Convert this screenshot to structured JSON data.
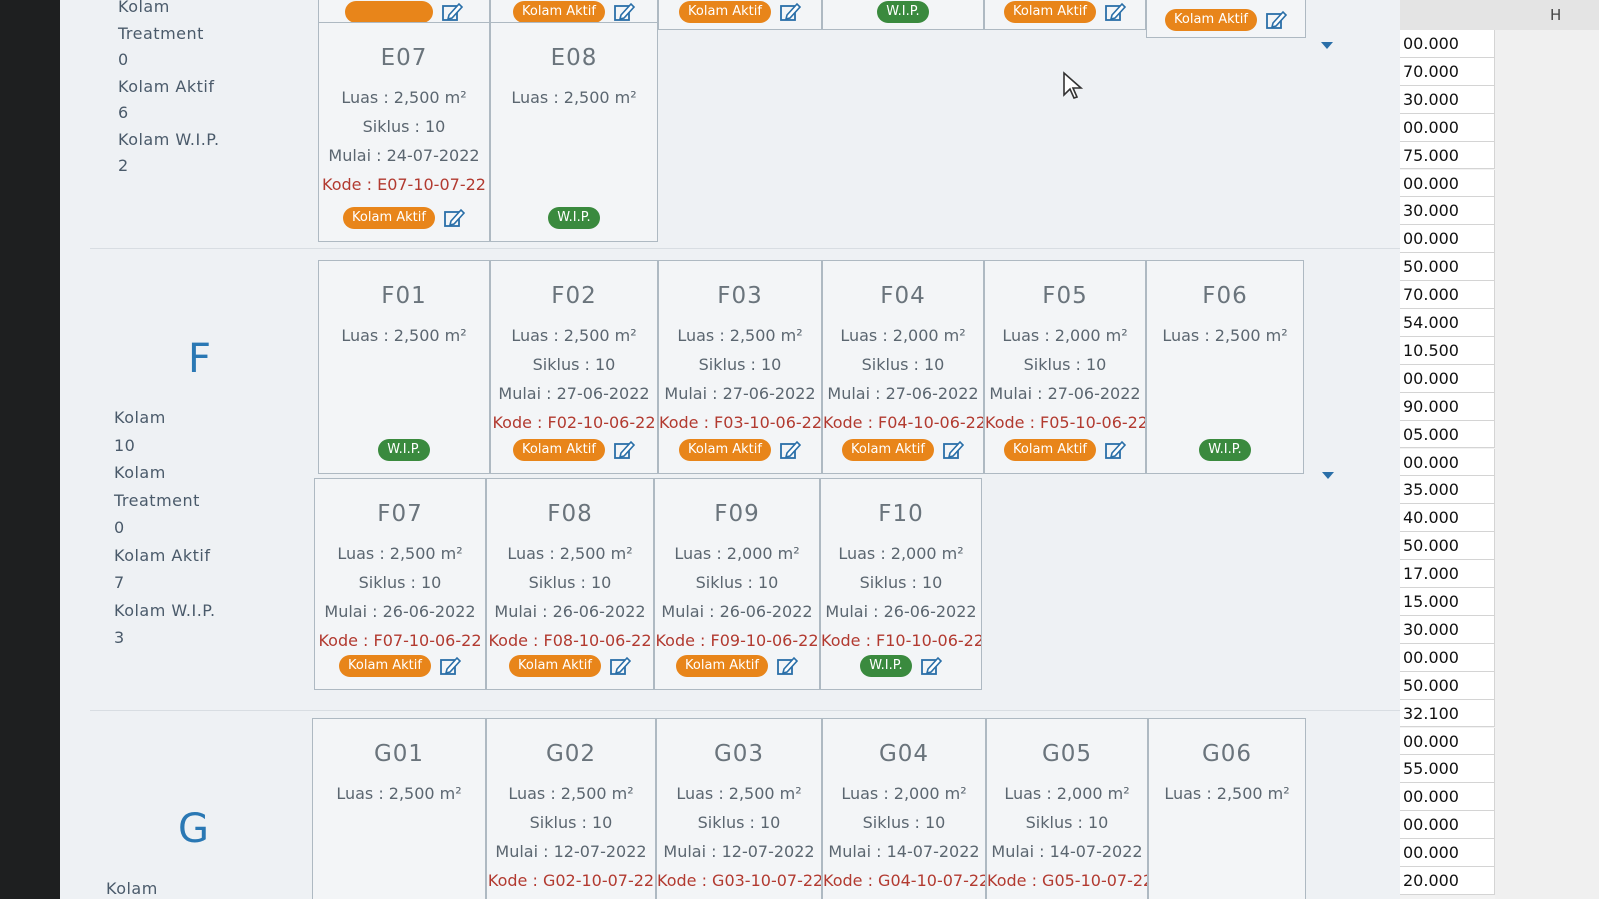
{
  "blocks": {
    "E": {
      "stats": [
        "Kolam",
        "Treatment",
        "0",
        "Kolam Aktif",
        "6",
        "Kolam W.I.P.",
        "2"
      ]
    },
    "F": {
      "letter": "F",
      "stats": [
        "Kolam",
        "10",
        "Kolam",
        "Treatment",
        "0",
        "Kolam Aktif",
        "7",
        "Kolam W.I.P.",
        "3"
      ]
    },
    "G": {
      "letter": "G",
      "stats": [
        "Kolam"
      ]
    }
  },
  "top_partial_badges": [
    "",
    "Kolam Aktif",
    "Kolam Aktif",
    "W.I.P.",
    "Kolam Aktif",
    "Kolam Aktif"
  ],
  "rows": {
    "e2": [
      {
        "code": "E07",
        "luas": "Luas : 2,500 m²",
        "siklus": "Siklus : 10",
        "mulai": "Mulai : 24-07-2022",
        "kode": "Kode : E07-10-07-22",
        "status": "Kolam Aktif"
      },
      {
        "code": "E08",
        "luas": "Luas : 2,500 m²",
        "status": "W.I.P."
      }
    ],
    "f1": [
      {
        "code": "F01",
        "luas": "Luas : 2,500 m²",
        "status": "W.I.P."
      },
      {
        "code": "F02",
        "luas": "Luas : 2,500 m²",
        "siklus": "Siklus : 10",
        "mulai": "Mulai : 27-06-2022",
        "kode": "Kode : F02-10-06-22",
        "status": "Kolam Aktif"
      },
      {
        "code": "F03",
        "luas": "Luas : 2,500 m²",
        "siklus": "Siklus : 10",
        "mulai": "Mulai : 27-06-2022",
        "kode": "Kode : F03-10-06-22",
        "status": "Kolam Aktif"
      },
      {
        "code": "F04",
        "luas": "Luas : 2,000 m²",
        "siklus": "Siklus : 10",
        "mulai": "Mulai : 27-06-2022",
        "kode": "Kode : F04-10-06-22",
        "status": "Kolam Aktif"
      },
      {
        "code": "F05",
        "luas": "Luas : 2,000 m²",
        "siklus": "Siklus : 10",
        "mulai": "Mulai : 27-06-2022",
        "kode": "Kode : F05-10-06-22",
        "status": "Kolam Aktif"
      },
      {
        "code": "F06",
        "luas": "Luas : 2,500 m²",
        "status": "W.I.P."
      }
    ],
    "f2": [
      {
        "code": "F07",
        "luas": "Luas : 2,500 m²",
        "siklus": "Siklus : 10",
        "mulai": "Mulai : 26-06-2022",
        "kode": "Kode : F07-10-06-22",
        "status": "Kolam Aktif"
      },
      {
        "code": "F08",
        "luas": "Luas : 2,500 m²",
        "siklus": "Siklus : 10",
        "mulai": "Mulai : 26-06-2022",
        "kode": "Kode : F08-10-06-22",
        "status": "Kolam Aktif"
      },
      {
        "code": "F09",
        "luas": "Luas : 2,000 m²",
        "siklus": "Siklus : 10",
        "mulai": "Mulai : 26-06-2022",
        "kode": "Kode : F09-10-06-22",
        "status": "Kolam Aktif"
      },
      {
        "code": "F10",
        "luas": "Luas : 2,000 m²",
        "siklus": "Siklus : 10",
        "mulai": "Mulai : 26-06-2022",
        "kode": "Kode : F10-10-06-22",
        "status": "W.I.P."
      }
    ],
    "g1": [
      {
        "code": "G01",
        "luas": "Luas : 2,500 m²"
      },
      {
        "code": "G02",
        "luas": "Luas : 2,500 m²",
        "siklus": "Siklus : 10",
        "mulai": "Mulai : 12-07-2022",
        "kode": "Kode : G02-10-07-22"
      },
      {
        "code": "G03",
        "luas": "Luas : 2,500 m²",
        "siklus": "Siklus : 10",
        "mulai": "Mulai : 12-07-2022",
        "kode": "Kode : G03-10-07-22"
      },
      {
        "code": "G04",
        "luas": "Luas : 2,000 m²",
        "siklus": "Siklus : 10",
        "mulai": "Mulai : 14-07-2022",
        "kode": "Kode : G04-10-07-22"
      },
      {
        "code": "G05",
        "luas": "Luas : 2,000 m²",
        "siklus": "Siklus : 10",
        "mulai": "Mulai : 14-07-2022",
        "kode": "Kode : G05-10-07-22"
      },
      {
        "code": "G06",
        "luas": "Luas : 2,500 m²"
      }
    ]
  },
  "spreadsheet": {
    "column_header": "H",
    "values": [
      "00.000",
      "70.000",
      "30.000",
      "00.000",
      "75.000",
      "00.000",
      "30.000",
      "00.000",
      "50.000",
      "70.000",
      "54.000",
      "10.500",
      "00.000",
      "90.000",
      "05.000",
      "00.000",
      "35.000",
      "40.000",
      "50.000",
      "17.000",
      "15.000",
      "30.000",
      "00.000",
      "50.000",
      "32.100",
      "00.000",
      "55.000",
      "00.000",
      "00.000",
      "00.000",
      "20.000"
    ]
  },
  "colors": {
    "aktif": "#e8851a",
    "wip": "#3a8a3e",
    "kode": "#b23a30",
    "letter": "#2a78b4"
  }
}
